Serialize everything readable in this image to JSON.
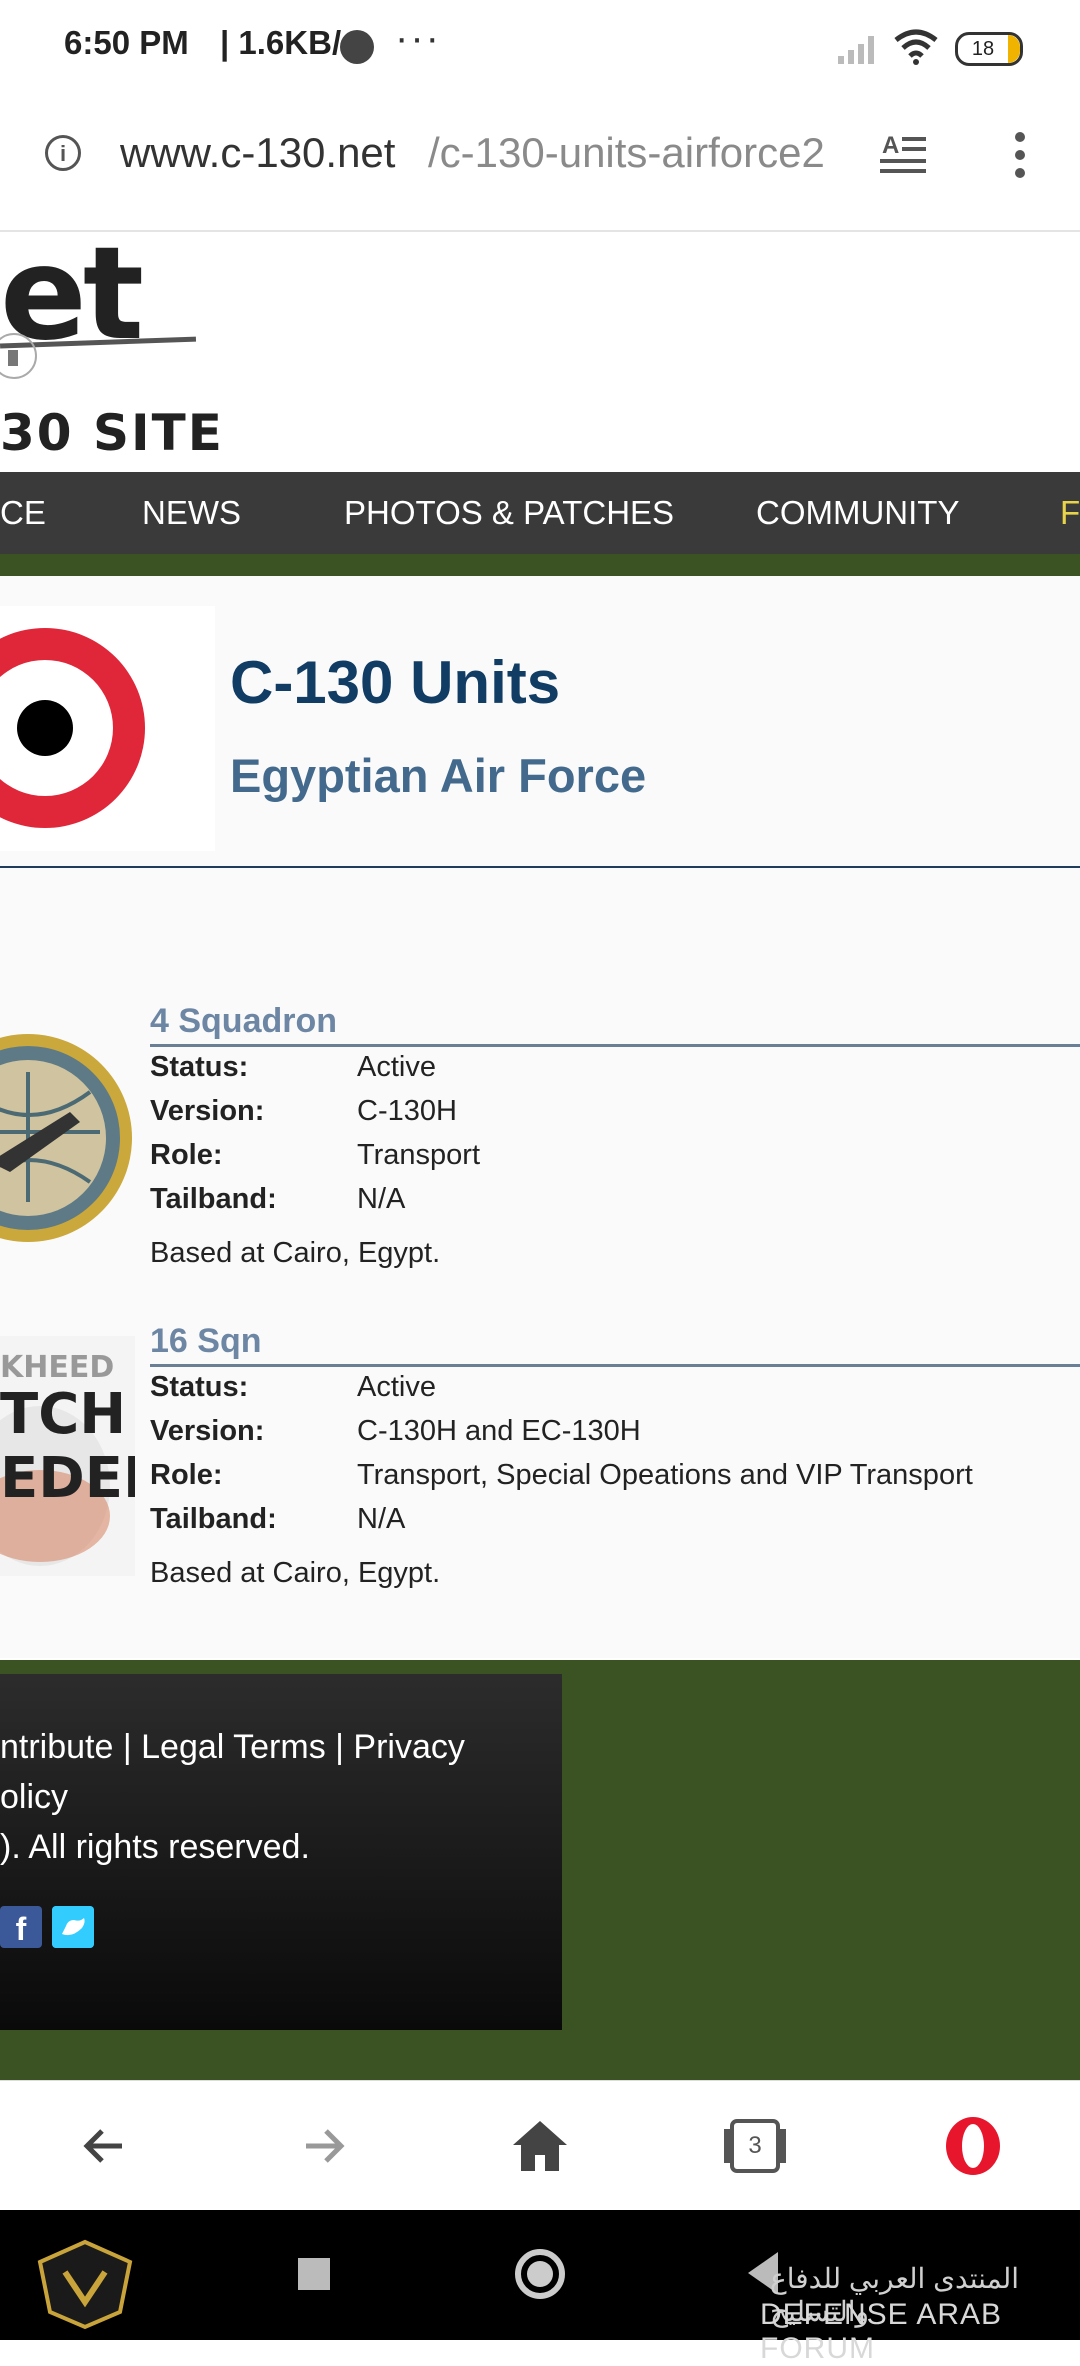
{
  "status_bar": {
    "time": "6:50 PM",
    "speed": "| 1.6KB/s",
    "dots": "···",
    "battery": "18",
    "battery_color": "#f0b400"
  },
  "address_bar": {
    "url_host": "www.c-130.net",
    "url_path": "/c-130-units-airforce2",
    "icons": [
      "info-icon",
      "reader-mode-icon",
      "overflow-menu-icon"
    ]
  },
  "site": {
    "logo_top": "et",
    "logo_bottom": "30 SITE",
    "nav": [
      {
        "label": "CE"
      },
      {
        "label": "NEWS"
      },
      {
        "label": "PHOTOS & PATCHES"
      },
      {
        "label": "COMMUNITY"
      },
      {
        "label": "F"
      }
    ],
    "nav_bg": "#3a3a3a",
    "accent_green": "#3b5323"
  },
  "page": {
    "title": "C-130 Units",
    "subtitle": "Egyptian Air Force",
    "title_color": "#113c63",
    "subtitle_color": "#436a8c"
  },
  "units": [
    {
      "name": "4 Squadron",
      "fields": [
        {
          "label": "Status:",
          "value": "Active"
        },
        {
          "label": "Version:",
          "value": "C-130H"
        },
        {
          "label": "Role:",
          "value": "Transport"
        },
        {
          "label": "Tailband:",
          "value": "N/A"
        }
      ],
      "based": "Based at Cairo, Egypt."
    },
    {
      "name": "16 Sqn",
      "fields": [
        {
          "label": "Status:",
          "value": "Active"
        },
        {
          "label": "Version:",
          "value": "C-130H and EC-130H"
        },
        {
          "label": "Role:",
          "value": "Transport, Special Opeations and VIP Transport"
        },
        {
          "label": "Tailband:",
          "value": "N/A"
        }
      ],
      "based": "Based at Cairo, Egypt.",
      "patch_text": [
        "KHEED",
        "TCH",
        "EDED"
      ]
    }
  ],
  "footer": {
    "line1": "ntribute | Legal Terms | Privacy",
    "line2": "olicy",
    "line3": "). All rights reserved.",
    "social": [
      "facebook-icon",
      "twitter-icon"
    ]
  },
  "browser_toolbar": {
    "tabs_count": "3",
    "buttons": [
      "back-icon",
      "forward-icon",
      "home-icon",
      "tabs-icon",
      "opera-icon"
    ]
  },
  "system_nav": {
    "watermark": "DEFENSE ARAB FORUM",
    "watermark_ar": "المنتدى العربي للدفاع والتسليح"
  }
}
